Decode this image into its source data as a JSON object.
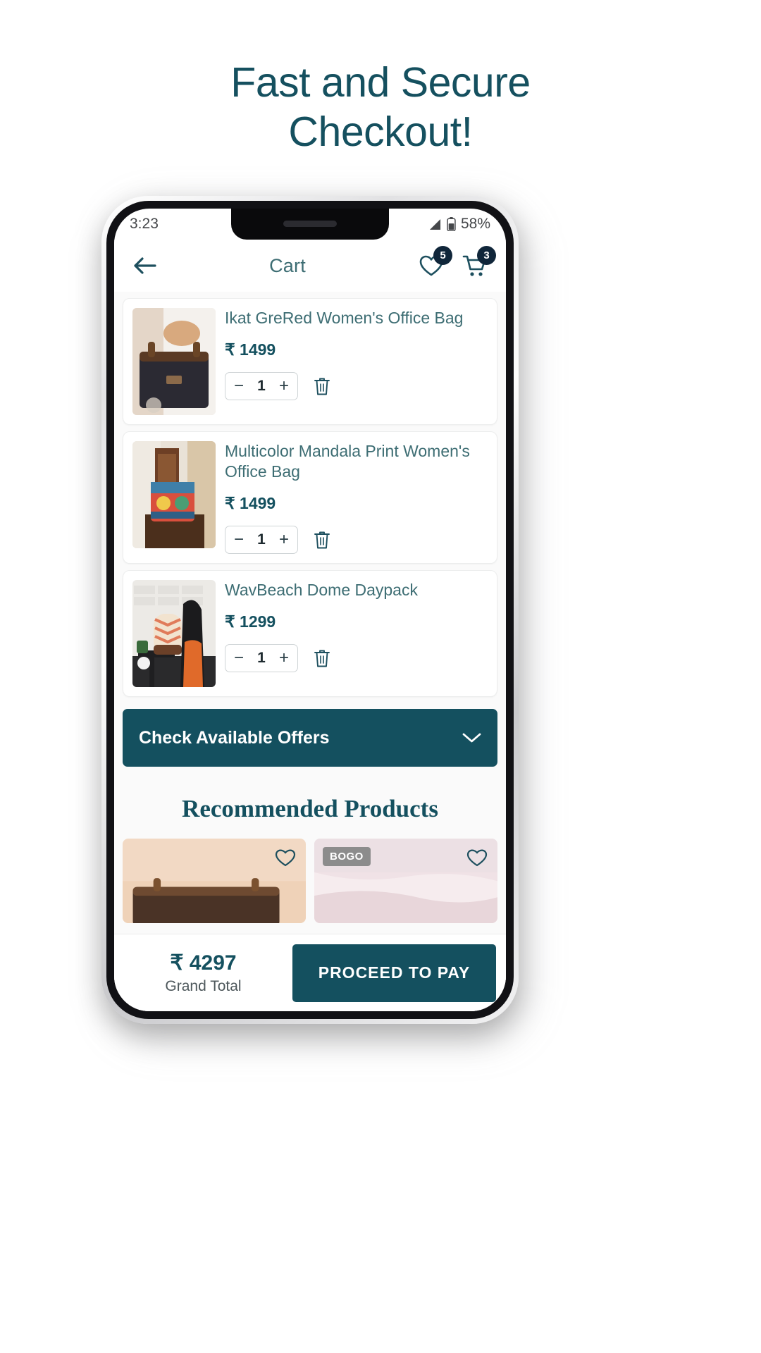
{
  "hero": {
    "line1": "Fast and Secure",
    "line2": "Checkout!",
    "color": "#15505f"
  },
  "status_bar": {
    "time": "3:23",
    "battery_percent": "58%",
    "signal_icon": "signal-bars-icon",
    "battery_icon": "battery-icon"
  },
  "header": {
    "back_icon": "back-arrow-icon",
    "title": "Cart",
    "wishlist_icon": "heart-icon",
    "wishlist_count": "5",
    "cart_icon": "shopping-cart-icon",
    "cart_count": "3"
  },
  "cart_items": [
    {
      "title": "Ikat GreRed Women's Office Bag",
      "price": "₹ 1499",
      "quantity": "1",
      "minus_label": "−",
      "plus_label": "+",
      "delete_icon": "trash-icon",
      "image_alt": "ikat-gre-red-office-bag-photo"
    },
    {
      "title": "Multicolor Mandala Print Women's Office Bag",
      "price": "₹ 1499",
      "quantity": "1",
      "minus_label": "−",
      "plus_label": "+",
      "delete_icon": "trash-icon",
      "image_alt": "multicolor-mandala-office-bag-photo"
    },
    {
      "title": "WavBeach Dome Daypack",
      "price": "₹ 1299",
      "quantity": "1",
      "minus_label": "−",
      "plus_label": "+",
      "delete_icon": "trash-icon",
      "image_alt": "wavbeach-dome-daypack-photo"
    }
  ],
  "offers": {
    "label": "Check Available Offers",
    "chevron_icon": "chevron-down-icon",
    "background": "#14505f"
  },
  "recommended": {
    "title": "Recommended Products",
    "cards": [
      {
        "badge": "",
        "heart_icon": "heart-icon",
        "image_alt": "recommended-brown-bag-photo"
      },
      {
        "badge": "BOGO",
        "heart_icon": "heart-icon",
        "image_alt": "recommended-pink-product-photo"
      }
    ]
  },
  "bottom_bar": {
    "grand_total_amount": "₹ 4297",
    "grand_total_label": "Grand Total",
    "pay_button_label": "PROCEED TO PAY",
    "accent": "#14505f"
  }
}
